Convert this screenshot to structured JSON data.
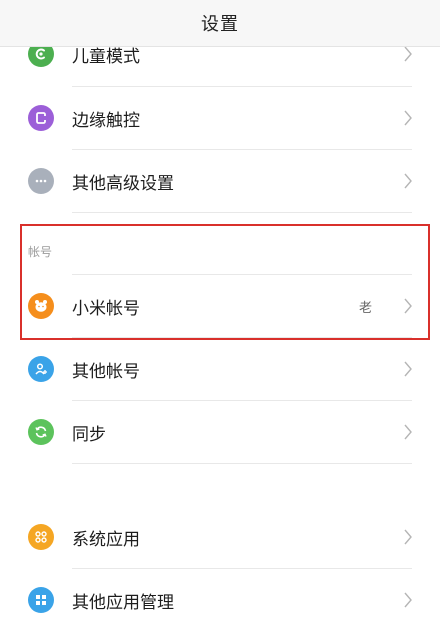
{
  "header": {
    "title": "设置"
  },
  "rows": {
    "child_mode": {
      "label": "儿童模式",
      "icon": "child-mode-icon",
      "color": "#4caf50"
    },
    "edge_touch": {
      "label": "边缘触控",
      "icon": "edge-touch-icon",
      "color": "#9c5fd8"
    },
    "advanced": {
      "label": "其他高级设置",
      "icon": "more-dots-icon",
      "color": "#a9b0bb"
    },
    "mi_account": {
      "label": "小米帐号",
      "value": "老",
      "icon": "mi-bear-icon",
      "color": "#f58e1c"
    },
    "other_accounts": {
      "label": "其他帐号",
      "icon": "person-add-icon",
      "color": "#3aa3e8"
    },
    "sync": {
      "label": "同步",
      "icon": "sync-icon",
      "color": "#5cc35c"
    },
    "system_apps": {
      "label": "系统应用",
      "icon": "grid-icon",
      "color": "#f5a623"
    },
    "app_manage": {
      "label": "其他应用管理",
      "icon": "app-manage-icon",
      "color": "#3aa3e8"
    }
  },
  "sections": {
    "account": "帐号"
  }
}
